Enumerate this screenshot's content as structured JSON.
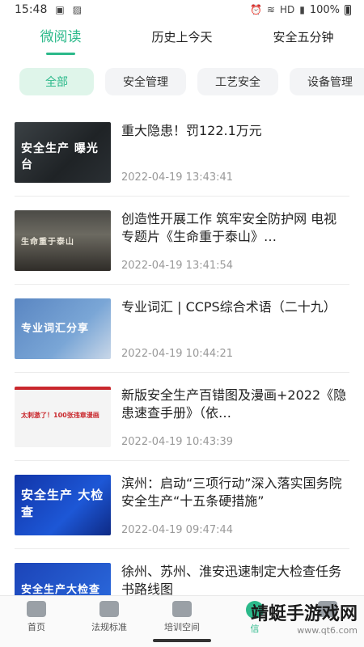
{
  "status_bar": {
    "time": "15:48",
    "network": "HD",
    "battery": "100%",
    "left_icons": [
      "notification-icon",
      "image-icon"
    ],
    "right_icons": [
      "alarm-icon",
      "wifi-icon",
      "signal-icon",
      "battery-icon"
    ]
  },
  "tabs": [
    {
      "label": "微阅读",
      "active": true
    },
    {
      "label": "历史上今天",
      "active": false
    },
    {
      "label": "安全五分钟",
      "active": false
    }
  ],
  "chips": [
    {
      "label": "全部",
      "active": true
    },
    {
      "label": "安全管理",
      "active": false
    },
    {
      "label": "工艺安全",
      "active": false
    },
    {
      "label": "设备管理",
      "active": false
    }
  ],
  "articles": [
    {
      "title": "重大隐患！罚122.1万元",
      "date": "2022-04-19 13:43:41",
      "thumb_text": "安全生产 曝光台"
    },
    {
      "title": "创造性开展工作 筑牢安全防护网 电视专题片《生命重于泰山》…",
      "date": "2022-04-19 13:41:54",
      "thumb_text": "生命重于泰山"
    },
    {
      "title": "专业词汇 | CCPS综合术语（二十九）",
      "date": "2022-04-19 10:44:21",
      "thumb_text": "专业词汇分享"
    },
    {
      "title": "新版安全生产百错图及漫画+2022《隐患速查手册》（依…",
      "date": "2022-04-19 10:43:39",
      "thumb_text": "太刺激了！100张违章漫画"
    },
    {
      "title": "滨州：启动“三项行动”深入落实国务院安全生产“十五条硬措施”",
      "date": "2022-04-19 09:47:44",
      "thumb_text": "安全生产 大检查"
    },
    {
      "title": "徐州、苏州、淮安迅速制定大检查任务书路线图",
      "date": "",
      "thumb_text": "安全生产大检查"
    }
  ],
  "bottom_nav": [
    {
      "label": "首页",
      "icon": "home-icon",
      "active": false
    },
    {
      "label": "法规标准",
      "icon": "shield-star-icon",
      "active": false
    },
    {
      "label": "培训空间",
      "icon": "bookmark-icon",
      "active": false
    },
    {
      "label": "信",
      "icon": "leaf-icon",
      "active": true
    },
    {
      "label": "",
      "icon": "profile-icon",
      "active": false
    }
  ],
  "watermark": {
    "text": "靖蜓手游戏网",
    "url": "www.qt6.com"
  },
  "colors": {
    "accent": "#2bb98a",
    "chip_active_bg": "#dff5ea",
    "date_text": "#999999"
  }
}
